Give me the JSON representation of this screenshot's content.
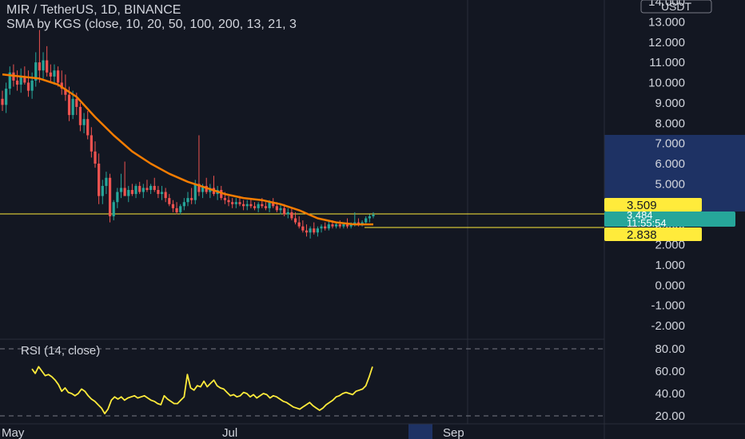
{
  "header": {
    "symbol_line": "MIR / TetherUS, 1D, BINANCE",
    "indicator_line": "SMA by KGS (close, 10, 20, 50, 100, 200, 13, 21, 3"
  },
  "currency_badge": "USDT",
  "colors": {
    "background": "#131722",
    "text": "#d1d4dc",
    "candle_up": "#26a69a",
    "candle_down": "#ef5350",
    "sma": "#f57c00",
    "level_line": "#ffeb3b",
    "rsi_line": "#ffeb3b",
    "price_badge": "#26a69a",
    "highlight_band": "#1e3264",
    "divider": "#434651"
  },
  "price_labels": {
    "resistance": "3.509",
    "current_price": "3.484",
    "countdown": "11:55:54",
    "support": "2.838"
  },
  "time_axis": [
    "May",
    "Jul",
    "Sep"
  ],
  "rsi_panel": {
    "label": "RSI (14, close)"
  },
  "chart_data": [
    {
      "type": "candlestick",
      "title": "MIR / TetherUS, 1D, BINANCE",
      "ylim": [
        -2.5,
        14
      ],
      "y_ticks": [
        "14.000",
        "13.000",
        "12.000",
        "11.000",
        "10.000",
        "9.000",
        "8.000",
        "7.000",
        "6.000",
        "5.000",
        "4.000",
        "3.000",
        "2.000",
        "1.000",
        "0.000",
        "-1.000",
        "-2.000"
      ],
      "x_ticks": [
        "May",
        "Jul",
        "Sep"
      ],
      "horizontal_levels": [
        3.509,
        2.838
      ],
      "last_price": 3.484,
      "series": [
        {
          "name": "MIR / TetherUS",
          "candles": [
            [
              9.2,
              9.6,
              8.6,
              8.9
            ],
            [
              8.9,
              10.0,
              8.5,
              9.7
            ],
            [
              9.7,
              10.8,
              9.4,
              10.5
            ],
            [
              10.5,
              10.9,
              9.8,
              10.1
            ],
            [
              10.1,
              10.6,
              9.6,
              9.9
            ],
            [
              9.9,
              10.7,
              9.5,
              10.3
            ],
            [
              10.3,
              10.8,
              9.9,
              10.0
            ],
            [
              10.0,
              10.6,
              9.3,
              9.6
            ],
            [
              9.6,
              10.5,
              9.2,
              10.1
            ],
            [
              10.1,
              11.5,
              9.8,
              11.0
            ],
            [
              11.0,
              12.6,
              10.0,
              10.6
            ],
            [
              10.6,
              11.5,
              10.2,
              11.1
            ],
            [
              11.1,
              11.8,
              10.3,
              10.5
            ],
            [
              10.5,
              10.9,
              10.0,
              10.3
            ],
            [
              10.3,
              10.9,
              9.9,
              10.6
            ],
            [
              10.6,
              10.8,
              9.8,
              10.0
            ],
            [
              10.0,
              10.6,
              9.4,
              9.7
            ],
            [
              9.7,
              10.4,
              9.1,
              9.4
            ],
            [
              9.4,
              9.8,
              8.1,
              8.4
            ],
            [
              8.4,
              9.6,
              8.2,
              9.2
            ],
            [
              9.2,
              9.5,
              8.4,
              8.8
            ],
            [
              8.8,
              9.0,
              7.6,
              7.9
            ],
            [
              7.9,
              8.5,
              7.5,
              8.2
            ],
            [
              8.2,
              8.6,
              7.2,
              7.4
            ],
            [
              7.4,
              7.8,
              6.3,
              6.6
            ],
            [
              6.6,
              7.1,
              5.8,
              6.0
            ],
            [
              6.0,
              6.5,
              4.0,
              4.4
            ],
            [
              4.4,
              5.2,
              4.0,
              4.9
            ],
            [
              4.9,
              5.6,
              4.5,
              5.3
            ],
            [
              5.3,
              5.5,
              3.1,
              3.4
            ],
            [
              3.4,
              4.2,
              3.2,
              4.1
            ],
            [
              4.1,
              4.8,
              3.8,
              4.6
            ],
            [
              4.6,
              5.5,
              4.3,
              4.8
            ],
            [
              4.8,
              6.1,
              4.5,
              4.4
            ],
            [
              4.4,
              4.9,
              4.1,
              4.7
            ],
            [
              4.7,
              5.0,
              4.4,
              4.5
            ],
            [
              4.5,
              5.0,
              4.3,
              4.9
            ],
            [
              4.9,
              5.1,
              4.5,
              4.6
            ],
            [
              4.6,
              5.0,
              4.3,
              4.8
            ],
            [
              4.8,
              5.2,
              4.6,
              4.7
            ],
            [
              4.7,
              5.0,
              4.5,
              4.9
            ],
            [
              4.9,
              5.3,
              4.6,
              4.7
            ],
            [
              4.7,
              4.9,
              4.3,
              4.5
            ],
            [
              4.5,
              4.9,
              4.2,
              4.6
            ],
            [
              4.6,
              4.8,
              4.1,
              4.3
            ],
            [
              4.3,
              4.5,
              3.9,
              4.0
            ],
            [
              4.0,
              4.2,
              3.6,
              3.8
            ],
            [
              3.8,
              4.1,
              3.5,
              3.6
            ],
            [
              3.6,
              4.0,
              3.5,
              3.9
            ],
            [
              3.9,
              4.3,
              3.7,
              4.1
            ],
            [
              4.1,
              4.6,
              3.9,
              4.3
            ],
            [
              4.3,
              4.8,
              4.0,
              4.2
            ],
            [
              4.2,
              5.2,
              4.0,
              5.0
            ],
            [
              5.0,
              7.4,
              4.4,
              4.6
            ],
            [
              4.6,
              5.0,
              4.3,
              4.9
            ],
            [
              4.9,
              5.3,
              4.5,
              4.6
            ],
            [
              4.6,
              5.0,
              4.3,
              4.8
            ],
            [
              4.8,
              5.4,
              4.4,
              4.5
            ],
            [
              4.5,
              4.9,
              4.2,
              4.7
            ],
            [
              4.7,
              4.9,
              4.2,
              4.3
            ],
            [
              4.3,
              4.6,
              4.0,
              4.2
            ],
            [
              4.2,
              4.4,
              3.9,
              4.1
            ],
            [
              4.1,
              4.3,
              3.8,
              4.0
            ],
            [
              4.0,
              4.3,
              3.8,
              4.1
            ],
            [
              4.1,
              4.4,
              3.9,
              4.0
            ],
            [
              4.0,
              4.2,
              3.7,
              3.9
            ],
            [
              3.9,
              4.2,
              3.7,
              4.0
            ],
            [
              4.0,
              4.3,
              3.8,
              3.9
            ],
            [
              3.9,
              4.1,
              3.7,
              3.8
            ],
            [
              3.8,
              4.1,
              3.6,
              4.0
            ],
            [
              4.0,
              4.3,
              3.8,
              3.9
            ],
            [
              3.9,
              4.1,
              3.7,
              3.8
            ],
            [
              3.8,
              4.2,
              3.6,
              4.1
            ],
            [
              4.1,
              4.3,
              3.8,
              3.9
            ],
            [
              3.9,
              4.1,
              3.6,
              3.7
            ],
            [
              3.7,
              4.0,
              3.5,
              3.8
            ],
            [
              3.8,
              4.0,
              3.4,
              3.5
            ],
            [
              3.5,
              3.8,
              3.3,
              3.6
            ],
            [
              3.6,
              3.8,
              3.2,
              3.3
            ],
            [
              3.3,
              3.6,
              3.0,
              3.1
            ],
            [
              3.1,
              3.4,
              2.8,
              2.9
            ],
            [
              2.9,
              3.2,
              2.6,
              2.7
            ],
            [
              2.7,
              3.0,
              2.4,
              2.6
            ],
            [
              2.6,
              2.9,
              2.3,
              2.8
            ],
            [
              2.8,
              3.1,
              2.5,
              2.6
            ],
            [
              2.6,
              2.9,
              2.4,
              2.8
            ],
            [
              2.8,
              3.0,
              2.6,
              2.9
            ],
            [
              2.9,
              3.1,
              2.7,
              2.8
            ],
            [
              2.8,
              3.2,
              2.7,
              3.0
            ],
            [
              3.0,
              3.2,
              2.8,
              2.9
            ],
            [
              2.9,
              3.1,
              2.8,
              3.0
            ],
            [
              3.0,
              3.2,
              2.8,
              2.9
            ],
            [
              2.9,
              3.1,
              2.8,
              3.0
            ],
            [
              3.0,
              3.3,
              2.8,
              2.9
            ],
            [
              2.9,
              3.1,
              2.8,
              3.0
            ],
            [
              3.0,
              3.6,
              2.9,
              3.1
            ],
            [
              3.1,
              3.3,
              2.9,
              3.0
            ],
            [
              3.0,
              3.2,
              2.9,
              3.1
            ],
            [
              3.1,
              3.4,
              3.0,
              3.3
            ],
            [
              3.3,
              3.5,
              3.1,
              3.4
            ],
            [
              3.4,
              3.6,
              3.3,
              3.48
            ]
          ]
        },
        {
          "name": "SMA",
          "values": [
            [
              0,
              10.4
            ],
            [
              5,
              10.3
            ],
            [
              10,
              10.2
            ],
            [
              15,
              9.9
            ],
            [
              20,
              9.3
            ],
            [
              25,
              8.3
            ],
            [
              30,
              7.4
            ],
            [
              35,
              6.6
            ],
            [
              40,
              6.0
            ],
            [
              45,
              5.5
            ],
            [
              50,
              5.1
            ],
            [
              55,
              4.8
            ],
            [
              60,
              4.5
            ],
            [
              65,
              4.3
            ],
            [
              70,
              4.2
            ],
            [
              75,
              4.0
            ],
            [
              80,
              3.7
            ],
            [
              85,
              3.3
            ],
            [
              90,
              3.1
            ],
            [
              95,
              3.0
            ],
            [
              100,
              3.0
            ]
          ]
        }
      ]
    },
    {
      "type": "line",
      "title": "RSI (14, close)",
      "ylim": [
        20,
        80
      ],
      "y_ticks": [
        "80.00",
        "60.00",
        "40.00",
        "20.00"
      ],
      "series": [
        {
          "name": "RSI",
          "values": [
            62,
            58,
            64,
            60,
            56,
            57,
            55,
            52,
            48,
            42,
            45,
            41,
            40,
            38,
            40,
            44,
            42,
            38,
            35,
            33,
            30,
            27,
            22,
            26,
            34,
            37,
            35,
            37,
            34,
            36,
            37,
            38,
            36,
            37,
            38,
            36,
            34,
            33,
            31,
            30,
            38,
            35,
            33,
            31,
            31,
            34,
            37,
            57,
            45,
            43,
            47,
            46,
            51,
            46,
            49,
            52,
            47,
            45,
            44,
            41,
            38,
            39,
            37,
            38,
            41,
            40,
            37,
            39,
            36,
            38,
            40,
            39,
            36,
            38,
            37,
            35,
            33,
            32,
            30,
            28,
            27,
            26,
            28,
            30,
            32,
            29,
            27,
            25,
            27,
            30,
            32,
            34,
            37,
            38,
            40,
            41,
            40,
            39,
            42,
            43,
            44,
            47,
            55,
            64
          ]
        }
      ]
    }
  ]
}
